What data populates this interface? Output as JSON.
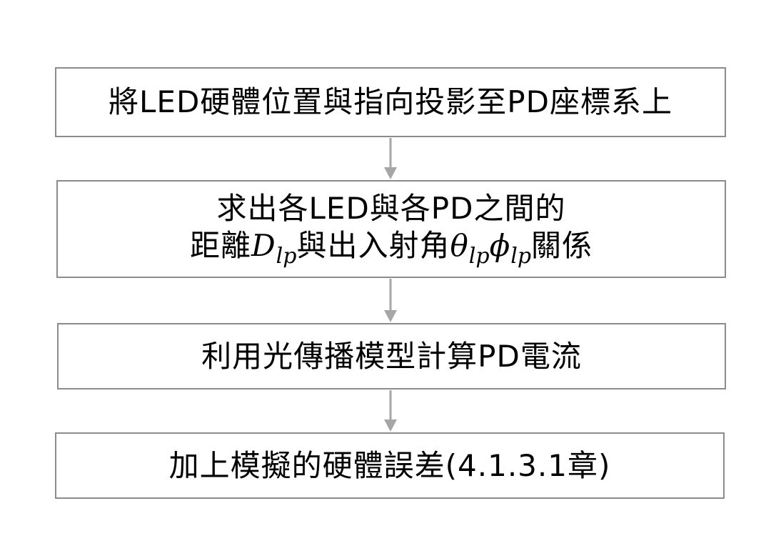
{
  "steps": [
    {
      "text": "將LED硬體位置與指向投影至PD座標系上"
    },
    {
      "line1": "求出各LED與各PD之間的",
      "line2_prefix": "距離",
      "distance_symbol": "D",
      "distance_subscript": "lp",
      "line2_mid": "與出入射角",
      "theta_symbol": "θ",
      "theta_subscript": "lp",
      "phi_symbol": "ϕ",
      "phi_subscript": "lp",
      "line2_suffix": "關係"
    },
    {
      "text": "利用光傳播模型計算PD電流"
    },
    {
      "text": "加上模擬的硬體誤差(4.1.3.1章)"
    }
  ],
  "colors": {
    "box_border": "#8c8c8c",
    "arrow": "#a6a6a6",
    "text": "#000000",
    "background": "#ffffff"
  }
}
